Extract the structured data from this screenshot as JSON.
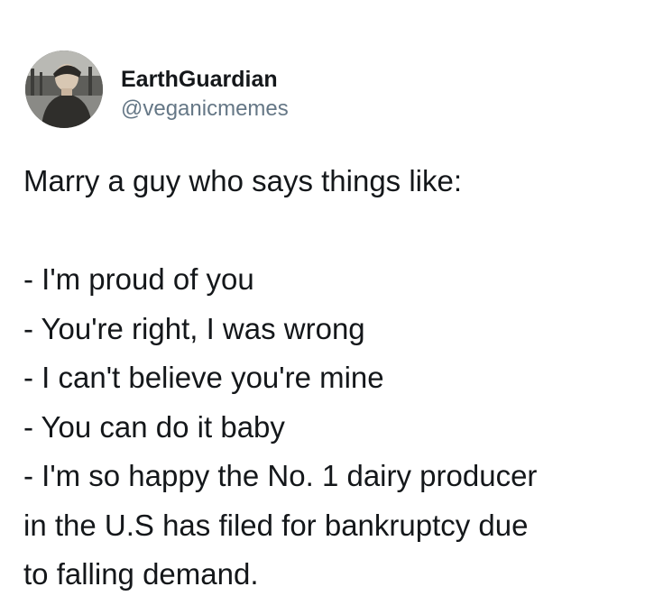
{
  "author": {
    "display_name": "EarthGuardian",
    "handle": "@veganicmemes",
    "avatar_icon": "profile-photo"
  },
  "tweet": {
    "lines": [
      "Marry a guy who says things like:",
      "",
      "- I'm proud of you",
      "- You're right, I was wrong",
      "- I can't believe you're mine",
      "- You can do it baby",
      "- I'm so happy the No. 1 dairy producer",
      "in the U.S has filed for bankruptcy due",
      "to falling demand."
    ]
  },
  "colors": {
    "text": "#14171a",
    "handle": "#657786",
    "background": "#ffffff"
  }
}
